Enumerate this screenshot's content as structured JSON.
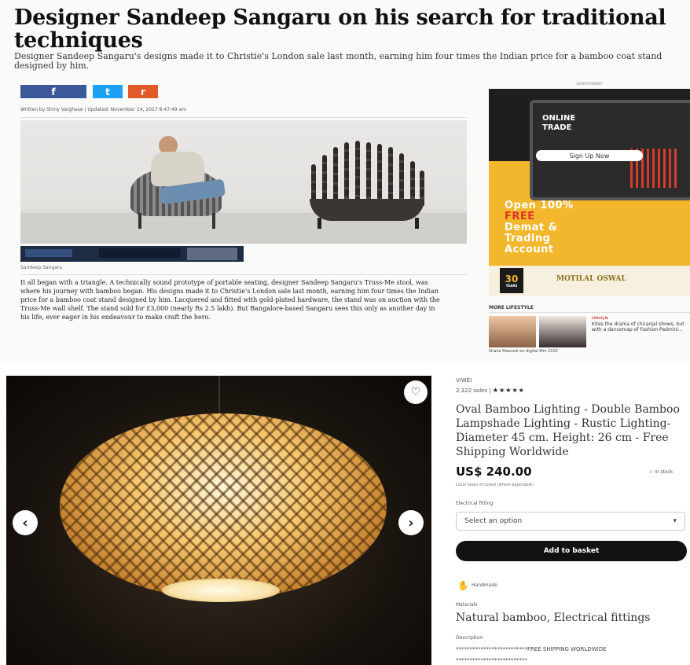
{
  "article": {
    "headline": "Designer Sandeep Sangaru on his search for traditional techniques",
    "subhead": "Designer Sandeep Sangaru's designs made it to Christie's London sale last month, earning him four times the Indian price for a bamboo coat stand designed by him.",
    "share": {
      "facebook": "f",
      "twitter": "t",
      "reddit": "r"
    },
    "byline": "Written by Shiny Varghese | Updated: November 14, 2017 8:47:49 am",
    "caption": "Sandeep Sangaru",
    "body": "It all began with a triangle. A technically sound prototype of portable seating, designer Sandeep Sangaru's Truss-Me stool, was where his journey with bamboo began. His designs made it to Christie's London sale last month, earning him four times the Indian price for a bamboo coat stand designed by him. Lacquered and fitted with gold-plated hardware, the stand was on auction with the Truss-Me wall shelf. The stand sold for £3,000 (nearly Rs 2.5 lakh). But Bangalore-based Sangaru sees this only as another day in his life, ever eager in his endeavour to make craft the hero."
  },
  "ad": {
    "label": "ADVERTISEMENT",
    "screen_text": "ONLINE TRADE",
    "signup": "Sign Up Now",
    "offer_line1": "Open 100%",
    "offer_free": "FREE",
    "offer_line3": "Demat &",
    "offer_line4": "Trading",
    "offer_line5": "Account",
    "badge_num": "30",
    "badge_years": "YEARS",
    "brand": "MOTILAL OSWAL"
  },
  "more_lifestyle": {
    "title": "MORE LIFESTYLE",
    "label": "Lifestyle",
    "text": "Kites the drama of chiranjal shows, but with a dancemap of Fashion Padmini...",
    "caption": "Shane Peacock on digital film 2022"
  },
  "product": {
    "seller": "VIWEI",
    "sales": "2,322 sales |",
    "stars": "★★★★★",
    "title": "Oval Bamboo Lighting - Double Bamboo Lampshade Lighting - Rustic Lighting- Diameter 45 cm. Height: 26 cm - Free Shipping Worldwide",
    "price": "US$ 240.00",
    "stock": "✓ In stock",
    "tax_note": "Local taxes included (where applicable)",
    "field_label": "Electrical fitting",
    "select_placeholder": "Select an option",
    "select_chevron": "▾",
    "basket_button": "Add to basket",
    "handmade_icon": "✋",
    "handmade": "Handmade",
    "materials_label": "Materials",
    "materials": "Natural bamboo, Electrical fittings",
    "description_label": "Description",
    "description_line1": "**************************FREE SHIPPING WORLDWIDE",
    "description_line2": "**************************",
    "fav_icon": "♡",
    "prev_icon": "‹",
    "next_icon": "›"
  }
}
